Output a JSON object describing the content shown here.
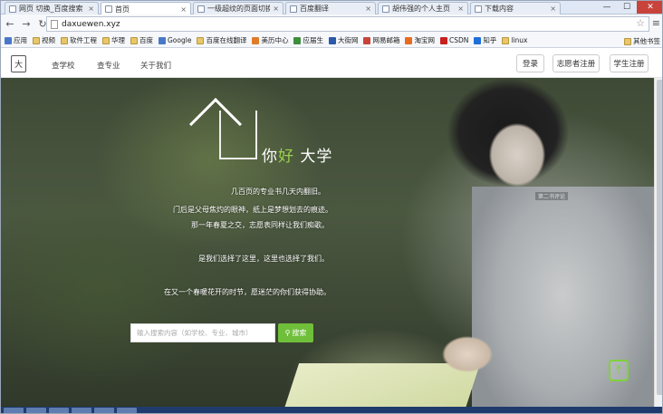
{
  "browser": {
    "tabs": [
      {
        "label": "网页 切换_百度搜索"
      },
      {
        "label": "首页"
      },
      {
        "label": "一级超纹的页面切换效果"
      },
      {
        "label": "百度翻译"
      },
      {
        "label": "胡伟强的个人主页"
      },
      {
        "label": "下载内容"
      }
    ],
    "url": "daxuewen.xyz",
    "bookmarks": [
      "应用",
      "视频",
      "软件工程",
      "华理",
      "百度",
      "Google",
      "百度在线翻译",
      "美历中心",
      "应届生",
      "大街网",
      "网易邮箱",
      "淘宝网",
      "CSDN",
      "知乎",
      "linux"
    ],
    "other_bookmarks": "其他书签",
    "window_controls": {
      "minimize": "—",
      "maximize": "☐",
      "close": "✕"
    }
  },
  "site": {
    "logo": "大",
    "nav": [
      "查学校",
      "查专业",
      "关于我们"
    ],
    "buttons": {
      "login": "登录",
      "volunteer_register": "志愿者注册",
      "student_register": "学生注册"
    },
    "brand": {
      "a": "你",
      "b": "好",
      "c": " 大学"
    },
    "tag": "第二书评论",
    "lines": [
      "几百页的专业书几天内翻旧。",
      "门后是父母焦灼的眼神，纸上是梦想划去的痕迹。",
      "那一年春夏之交，志愿表同样让我们痴歌。",
      "是我们选择了这里，这里也选择了我们。",
      "在又一个春暖花开的时节，愿迷茫的你们获得协助。"
    ],
    "search": {
      "placeholder": "输入搜索内容（如学校、专业、城市）",
      "button": "搜索"
    }
  }
}
